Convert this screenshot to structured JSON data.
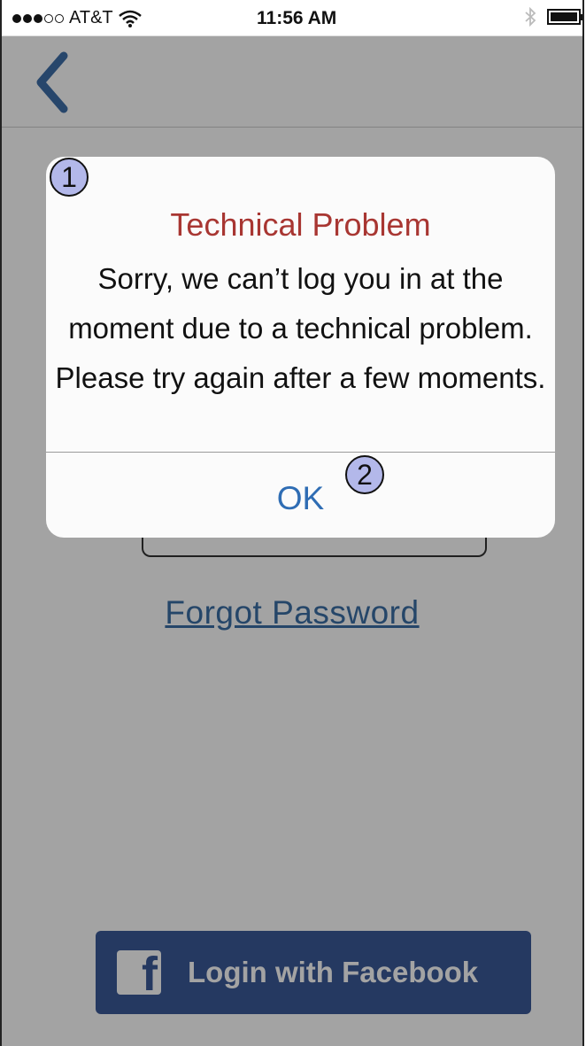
{
  "status_bar": {
    "carrier": "AT&T",
    "time": "11:56 AM",
    "signal_icon": "signal-dots-icon",
    "wifi_icon": "wifi-icon",
    "bluetooth_icon": "bluetooth-icon",
    "battery_icon": "battery-icon"
  },
  "nav": {
    "back_icon": "chevron-left-icon"
  },
  "login": {
    "forgot_password": "Forgot Password",
    "facebook_button": "Login with Facebook",
    "facebook_icon": "facebook-icon"
  },
  "alert": {
    "title": "Technical Problem",
    "message": "Sorry, we can’t log you in at the moment due to a technical problem. Please try again after a few moments.",
    "ok_label": "OK"
  },
  "annotations": {
    "marker_1": "1",
    "marker_2": "2"
  },
  "colors": {
    "alert_title": "#a83632",
    "link": "#2f6db4",
    "facebook": "#3b5998"
  }
}
